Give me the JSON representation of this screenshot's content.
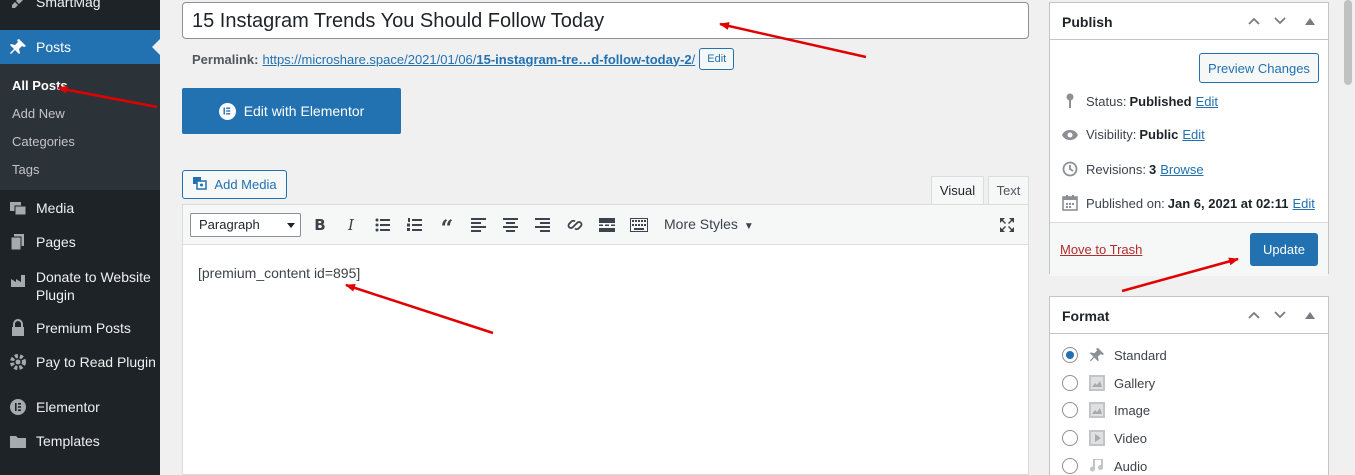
{
  "sidebar": {
    "top_item": "SmartMag",
    "posts": "Posts",
    "submenu": [
      "All Posts",
      "Add New",
      "Categories",
      "Tags"
    ],
    "items": [
      "Media",
      "Pages",
      "Donate to Website Plugin",
      "Premium Posts",
      "Pay to Read Plugin",
      "Elementor",
      "Templates"
    ]
  },
  "editor": {
    "title": "15 Instagram Trends You Should Follow Today",
    "permalink_label": "Permalink:",
    "permalink_prefix": "https://microshare.space/2021/01/06/",
    "permalink_slug": "15-instagram-tre…d-follow-today-2",
    "permalink_suffix": "/",
    "permalink_edit": "Edit",
    "elementor_button": "Edit with Elementor",
    "add_media": "Add Media",
    "tab_visual": "Visual",
    "tab_text": "Text",
    "format_select": "Paragraph",
    "more_styles": "More Styles",
    "content": "[premium_content id=895]"
  },
  "publish": {
    "title": "Publish",
    "preview": "Preview Changes",
    "status_label": "Status:",
    "status_value": "Published",
    "visibility_label": "Visibility:",
    "visibility_value": "Public",
    "revisions_label": "Revisions:",
    "revisions_value": "3",
    "browse": "Browse",
    "published_label": "Published on:",
    "published_value": "Jan 6, 2021 at 02:11",
    "edit": "Edit",
    "trash": "Move to Trash",
    "update": "Update"
  },
  "format": {
    "title": "Format",
    "options": [
      "Standard",
      "Gallery",
      "Image",
      "Video",
      "Audio"
    ],
    "selected": "Standard"
  },
  "colors": {
    "accent": "#2271b1",
    "sidebar": "#1d2327",
    "annotation": "#e00000",
    "trash": "#b32d2e"
  }
}
